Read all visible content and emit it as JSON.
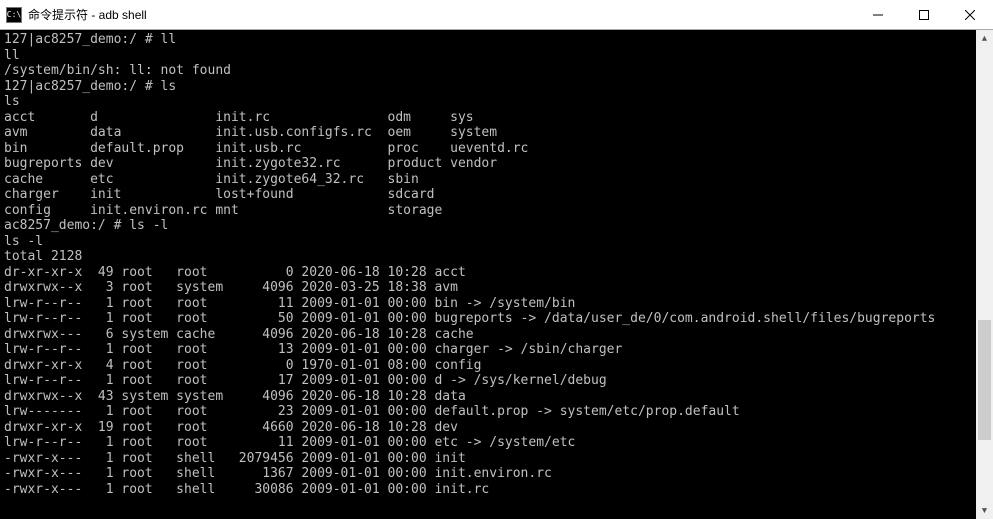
{
  "window": {
    "icon_label": "C:\\",
    "title": "命令提示符 - adb  shell",
    "minimize": "—",
    "maximize": "□",
    "close": "×"
  },
  "terminal": {
    "lines": [
      "127|ac8257_demo:/ # ll",
      "ll",
      "/system/bin/sh: ll: not found",
      "127|ac8257_demo:/ # ls",
      "ls",
      "acct       d               init.rc               odm     sys",
      "avm        data            init.usb.configfs.rc  oem     system",
      "bin        default.prop    init.usb.rc           proc    ueventd.rc",
      "bugreports dev             init.zygote32.rc      product vendor",
      "cache      etc             init.zygote64_32.rc   sbin",
      "charger    init            lost+found            sdcard",
      "config     init.environ.rc mnt                   storage",
      "ac8257_demo:/ # ls -l",
      "ls -l",
      "total 2128",
      "dr-xr-xr-x  49 root   root          0 2020-06-18 10:28 acct",
      "drwxrwx--x   3 root   system     4096 2020-03-25 18:38 avm",
      "lrw-r--r--   1 root   root         11 2009-01-01 00:00 bin -> /system/bin",
      "lrw-r--r--   1 root   root         50 2009-01-01 00:00 bugreports -> /data/user_de/0/com.android.shell/files/bugreports",
      "drwxrwx---   6 system cache      4096 2020-06-18 10:28 cache",
      "lrw-r--r--   1 root   root         13 2009-01-01 00:00 charger -> /sbin/charger",
      "drwxr-xr-x   4 root   root          0 1970-01-01 08:00 config",
      "lrw-r--r--   1 root   root         17 2009-01-01 00:00 d -> /sys/kernel/debug",
      "drwxrwx--x  43 system system     4096 2020-06-18 10:28 data",
      "lrw-------   1 root   root         23 2009-01-01 00:00 default.prop -> system/etc/prop.default",
      "drwxr-xr-x  19 root   root       4660 2020-06-18 10:28 dev",
      "lrw-r--r--   1 root   root         11 2009-01-01 00:00 etc -> /system/etc",
      "-rwxr-x---   1 root   shell   2079456 2009-01-01 00:00 init",
      "-rwxr-x---   1 root   shell      1367 2009-01-01 00:00 init.environ.rc",
      "-rwxr-x---   1 root   shell     30086 2009-01-01 00:00 init.rc"
    ]
  },
  "scrollbar": {
    "up": "▲",
    "down": "▼"
  }
}
